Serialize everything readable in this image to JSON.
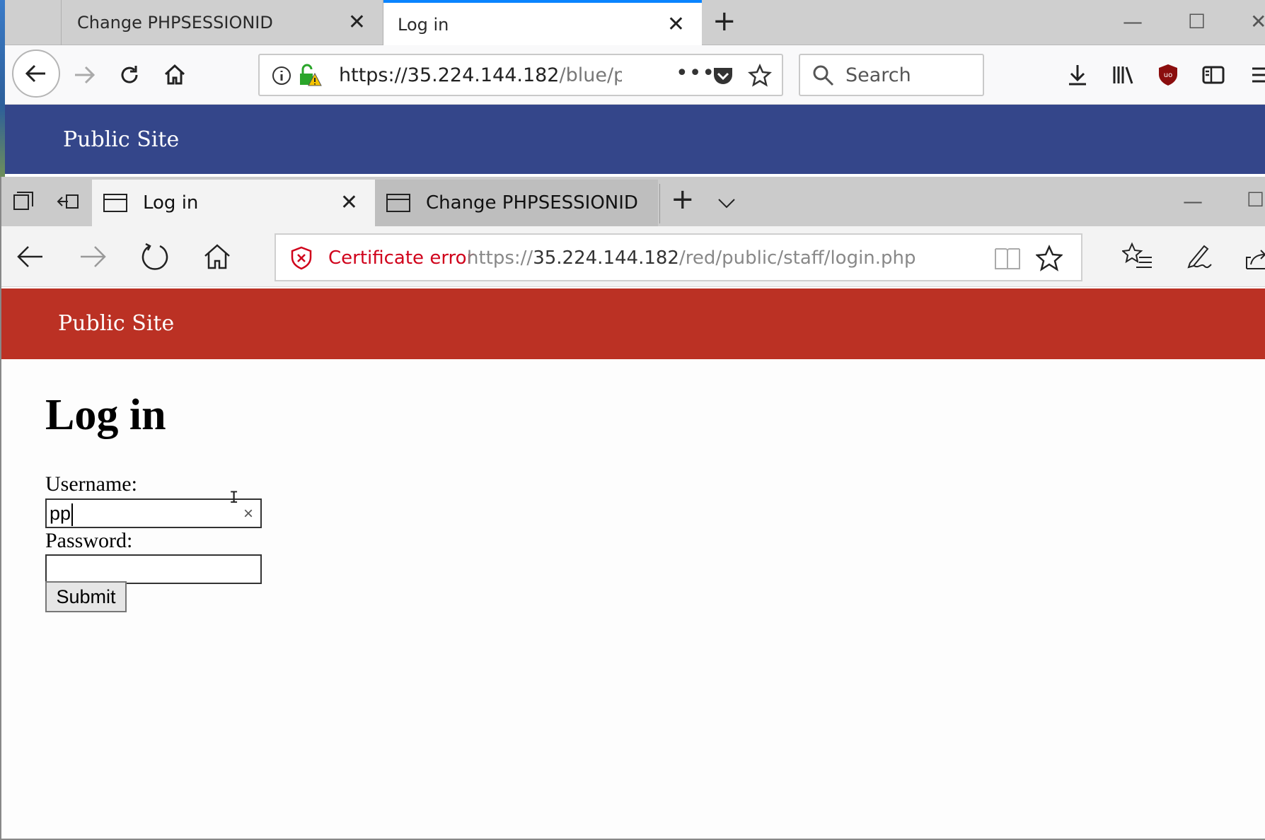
{
  "firefox": {
    "tabs": [
      {
        "label": "Change PHPSESSIONID"
      },
      {
        "label": "Log in"
      }
    ],
    "url": {
      "host": "https://35.224.144.182",
      "path": "/blue/pub"
    },
    "search_placeholder": "Search",
    "banner_title": "Public Site",
    "accent_color": "#34468a"
  },
  "edge": {
    "tabs": [
      {
        "label": "Log in"
      },
      {
        "label": "Change PHPSESSIONID"
      }
    ],
    "certificate_warning": "Certificate error",
    "url": {
      "scheme": "https://",
      "host": "35.224.144.182",
      "path": "/red/public/staff/login.php"
    },
    "banner_title": "Public Site",
    "accent_color": "#bb3124"
  },
  "page": {
    "title": "Log in",
    "username_label": "Username:",
    "username_value": "pp",
    "password_label": "Password:",
    "password_value": "",
    "submit_label": "Submit"
  }
}
